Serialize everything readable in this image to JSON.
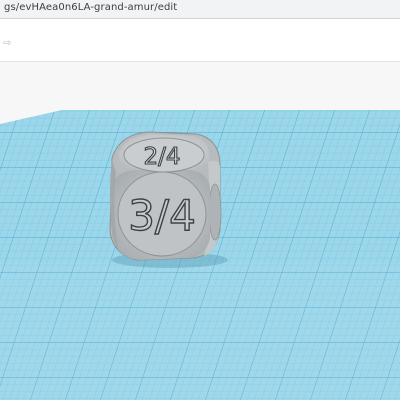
{
  "browser": {
    "url": "gs/evHAea0n6LA-grand-amur/edit"
  },
  "toolbar": {
    "nav_arrow_icon": "arrow-right-icon"
  },
  "model": {
    "top_face_label": "2/4",
    "front_face_label": "3/4",
    "color": "#cfd2d4"
  },
  "workplane": {
    "color": "#8fd3e8",
    "grid_color": "#5fb6d4"
  }
}
